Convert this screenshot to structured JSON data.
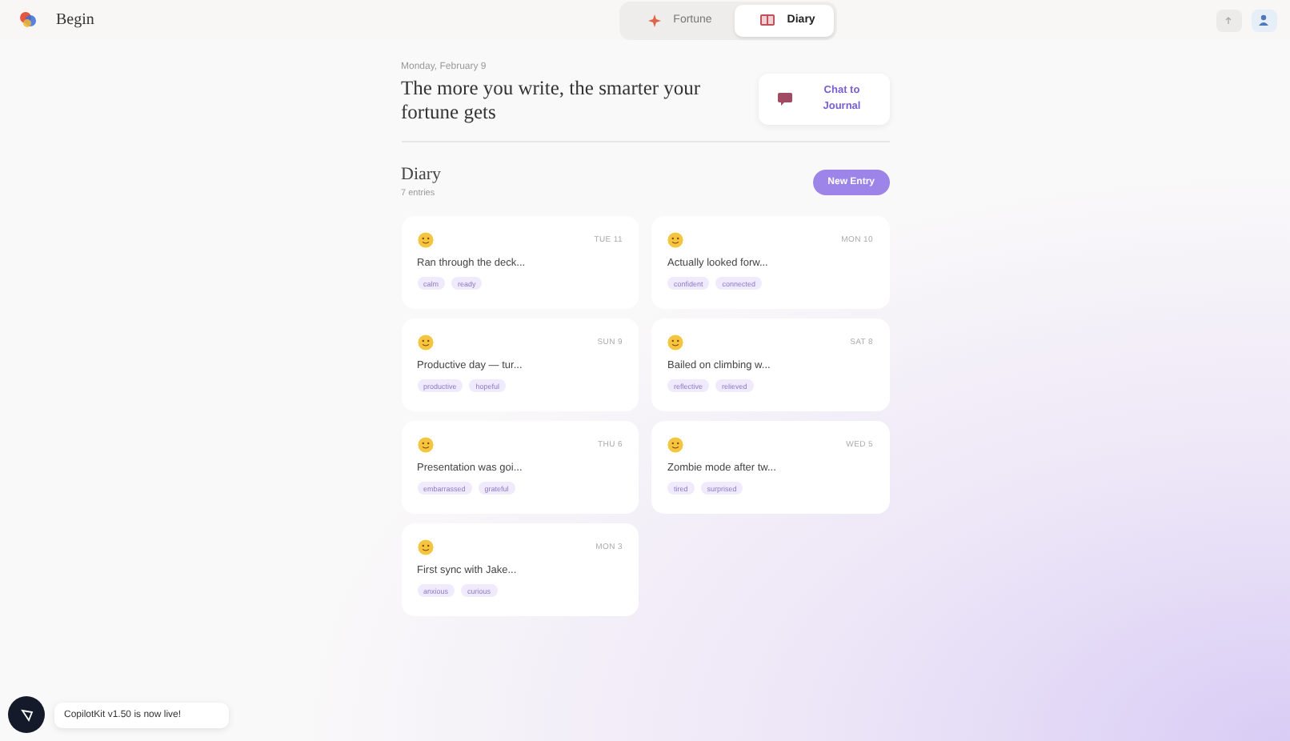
{
  "header": {
    "brand": "Begin",
    "tabs": [
      {
        "label": "Fortune",
        "kind": "fortune",
        "selected": false
      },
      {
        "label": "Diary",
        "kind": "diary",
        "selected": true
      }
    ]
  },
  "hero": {
    "date": "Monday, February 9",
    "title": "The more you write, the smarter your fortune gets",
    "chat_button": "Chat to Journal"
  },
  "diary": {
    "title": "Diary",
    "count": "7 entries",
    "new_button": "New Entry",
    "entries": [
      {
        "date": "TUE 11",
        "text": "Ran through the deck...",
        "tags": [
          "calm",
          "ready"
        ]
      },
      {
        "date": "MON 10",
        "text": "Actually looked forw...",
        "tags": [
          "confident",
          "connected"
        ]
      },
      {
        "date": "SUN 9",
        "text": "Productive day — tur...",
        "tags": [
          "productive",
          "hopeful"
        ]
      },
      {
        "date": "SAT 8",
        "text": "Bailed on climbing w...",
        "tags": [
          "reflective",
          "relieved"
        ]
      },
      {
        "date": "THU 6",
        "text": "Presentation was goi...",
        "tags": [
          "embarrassed",
          "grateful"
        ]
      },
      {
        "date": "WED 5",
        "text": "Zombie mode after tw...",
        "tags": [
          "tired",
          "surprised"
        ]
      },
      {
        "date": "MON 3",
        "text": "First sync with Jake...",
        "tags": [
          "anxious",
          "curious"
        ]
      }
    ]
  },
  "toast": {
    "text": "CopilotKit v1.50 is now live!"
  }
}
